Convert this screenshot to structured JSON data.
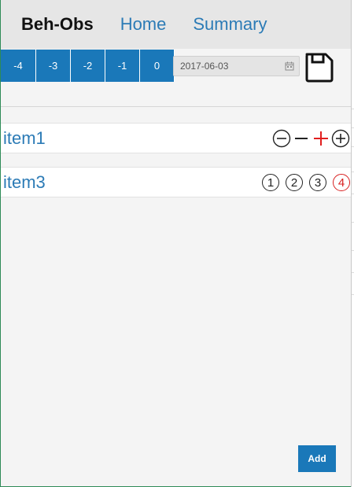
{
  "navbar": {
    "brand": "Beh-Obs",
    "links": [
      "Home",
      "Summary"
    ]
  },
  "toolbar": {
    "day_offsets": [
      "-4",
      "-3",
      "-2",
      "-1",
      "0"
    ],
    "date_value": "2017-06-03"
  },
  "items": [
    {
      "label": "item1",
      "control_type": "counter"
    },
    {
      "label": "item3",
      "control_type": "rating",
      "options": [
        "1",
        "2",
        "3",
        "4"
      ],
      "selected": "4"
    }
  ],
  "add_button": "Add",
  "colors": {
    "primary": "#1a78b9",
    "link": "#2c7bb6",
    "highlight": "#e11e1e",
    "navbar_bg": "#e6e6e6",
    "page_bg": "#f4f4f4"
  },
  "icons": {
    "date_picker": "calendar-icon",
    "save": "floppy-disk-icon",
    "decrement": "circle-minus-icon",
    "increment": "circle-plus-icon"
  }
}
